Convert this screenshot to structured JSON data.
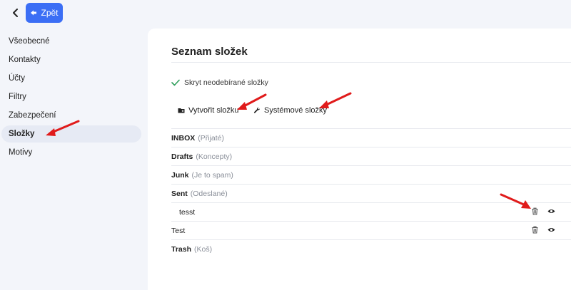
{
  "header": {
    "back_label": "Zpět"
  },
  "sidebar": {
    "items": [
      {
        "label": "Všeobecné",
        "active": false
      },
      {
        "label": "Kontakty",
        "active": false
      },
      {
        "label": "Účty",
        "active": false
      },
      {
        "label": "Filtry",
        "active": false
      },
      {
        "label": "Zabezpečení",
        "active": false
      },
      {
        "label": "Složky",
        "active": true
      },
      {
        "label": "Motivy",
        "active": false
      }
    ]
  },
  "main": {
    "title": "Seznam složek",
    "hide_unsubscribed_label": "Skryt neodebírané složky",
    "create_folder_label": "Vytvořit složku",
    "system_folders_label": "Systémové složky",
    "folders": [
      {
        "name": "INBOX",
        "sub": "(Přijaté)",
        "bold": true,
        "indent": false,
        "actions": false
      },
      {
        "name": "Drafts",
        "sub": "(Koncepty)",
        "bold": true,
        "indent": false,
        "actions": false
      },
      {
        "name": "Junk",
        "sub": "(Je to spam)",
        "bold": true,
        "indent": false,
        "actions": false
      },
      {
        "name": "Sent",
        "sub": "(Odeslané)",
        "bold": true,
        "indent": false,
        "actions": false
      },
      {
        "name": "tesst",
        "sub": "",
        "bold": false,
        "indent": true,
        "actions": true
      },
      {
        "name": "Test",
        "sub": "",
        "bold": false,
        "indent": false,
        "actions": true
      },
      {
        "name": "Trash",
        "sub": "(Koš)",
        "bold": true,
        "indent": false,
        "actions": false
      }
    ]
  },
  "colors": {
    "accent": "#3b6ef5",
    "annotation_arrow": "#e01b1b",
    "check": "#2e9e5b"
  }
}
